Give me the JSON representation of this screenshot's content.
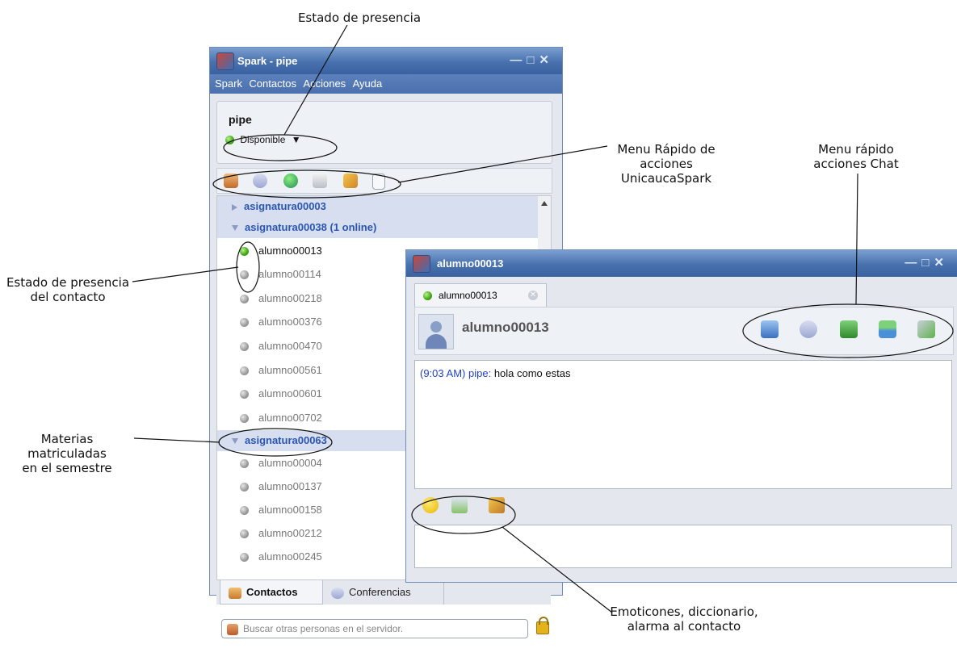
{
  "annotations": {
    "presence_state": "Estado de presencia",
    "quick_menu_1": "Menu Rápido de",
    "quick_menu_2": "acciones",
    "quick_menu_3": "UnicaucaSpark",
    "chat_menu_1": "Menu rápido",
    "chat_menu_2": "acciones Chat",
    "contact_presence_1": "Estado de presencia",
    "contact_presence_2": "del contacto",
    "courses_1": "Materias matriculadas",
    "courses_2": "en el semestre",
    "emoticons_1": "Emoticones, diccionario,",
    "emoticons_2": "alarma al contacto"
  },
  "main_window": {
    "title": "Spark - pipe",
    "menu": [
      "Spark",
      "Contactos",
      "Acciones",
      "Ayuda"
    ],
    "username": "pipe",
    "status": "Disponible",
    "groups": [
      {
        "label": "asignatura00003",
        "expanded": false
      },
      {
        "label": "asignatura00038 (1 online)",
        "expanded": true,
        "contacts": [
          "alumno00013",
          "alumno00114",
          "alumno00218",
          "alumno00376",
          "alumno00470",
          "alumno00561",
          "alumno00601",
          "alumno00702"
        ]
      },
      {
        "label": "asignatura00063",
        "expanded": true,
        "contacts": [
          "alumno00004",
          "alumno00137",
          "alumno00158",
          "alumno00212",
          "alumno00245"
        ]
      }
    ],
    "tabs": [
      "Contactos",
      "Conferencias"
    ],
    "search_placeholder": "Buscar otras personas en el servidor."
  },
  "chat_window": {
    "title": "alumno00013",
    "tab_label": "alumno00013",
    "contact_name": "alumno00013",
    "message": {
      "time": "(9:03 AM)",
      "sender": "pipe:",
      "text": "hola como estas"
    }
  },
  "icons": {
    "toolbar": [
      "add-contact-icon",
      "conference-icon",
      "presence-globe-icon",
      "broadcast-icon",
      "broom-icon",
      "notes-icon"
    ],
    "chat_toolbar": [
      "profile-card-icon",
      "conference-icon",
      "download-icon",
      "image-icon",
      "phone-icon"
    ],
    "chat_bottom": [
      "smiley-icon",
      "spellcheck-icon",
      "bell-icon"
    ]
  },
  "colors": {
    "titlebar": "#4770ad",
    "group_text": "#2a56b0",
    "online": "#3fa512",
    "offline": "#9a9a9a"
  }
}
